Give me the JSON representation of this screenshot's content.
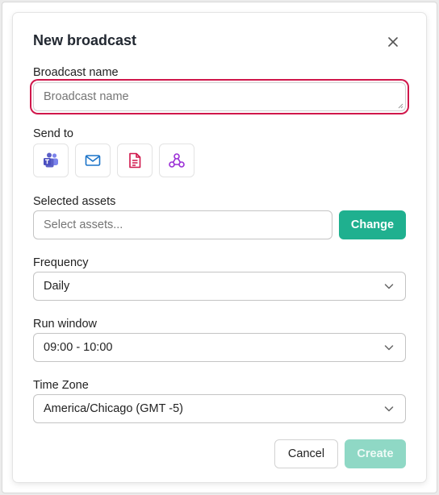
{
  "dialog": {
    "title": "New broadcast",
    "close_icon": "close-icon"
  },
  "broadcast_name": {
    "label": "Broadcast name",
    "value": "",
    "placeholder": "Broadcast name"
  },
  "send_to": {
    "label": "Send to",
    "channels": [
      {
        "icon": "teams-icon",
        "color": "#5b5fc7"
      },
      {
        "icon": "email-icon",
        "color": "#1a73c8"
      },
      {
        "icon": "document-icon",
        "color": "#d0174b"
      },
      {
        "icon": "webhook-icon",
        "color": "#9b2fd6"
      }
    ]
  },
  "selected_assets": {
    "label": "Selected assets",
    "placeholder": "Select assets...",
    "value": "",
    "change_label": "Change"
  },
  "frequency": {
    "label": "Frequency",
    "value": "Daily"
  },
  "run_window": {
    "label": "Run window",
    "value": "09:00 - 10:00"
  },
  "time_zone": {
    "label": "Time Zone",
    "value": "America/Chicago (GMT -5)"
  },
  "footer": {
    "cancel_label": "Cancel",
    "create_label": "Create"
  },
  "colors": {
    "accent": "#1fb08f",
    "accent_disabled": "#8fd8c5",
    "focus_ring": "#d0174b"
  }
}
